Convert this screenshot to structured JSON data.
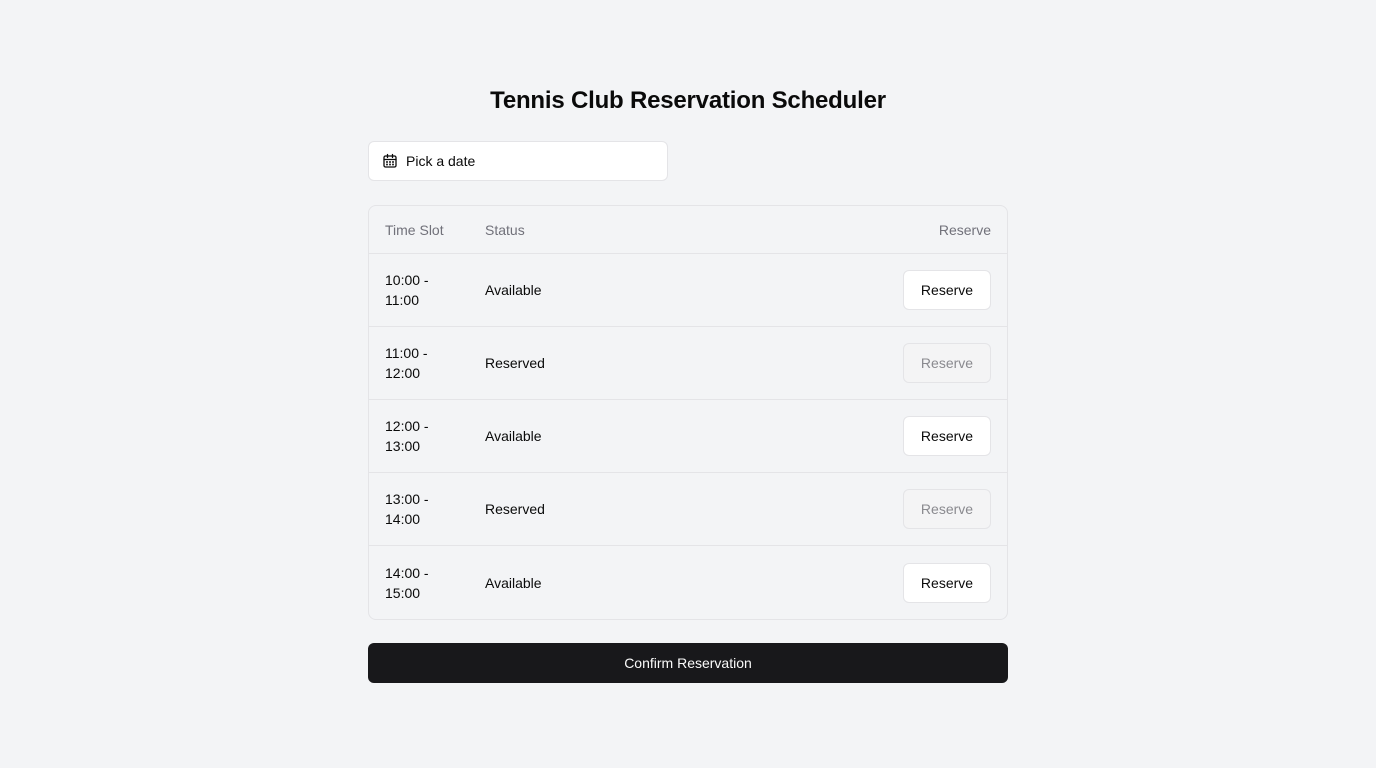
{
  "page": {
    "title": "Tennis Club Reservation Scheduler"
  },
  "date_picker": {
    "icon": "calendar-icon",
    "placeholder": "Pick a date"
  },
  "table": {
    "headers": {
      "time_slot": "Time Slot",
      "status": "Status",
      "reserve": "Reserve"
    },
    "rows": [
      {
        "time_start": "10:00 -",
        "time_end": "11:00",
        "status": "Available",
        "action": "Reserve",
        "disabled": false
      },
      {
        "time_start": "11:00 -",
        "time_end": "12:00",
        "status": "Reserved",
        "action": "Reserve",
        "disabled": true
      },
      {
        "time_start": "12:00 -",
        "time_end": "13:00",
        "status": "Available",
        "action": "Reserve",
        "disabled": false
      },
      {
        "time_start": "13:00 -",
        "time_end": "14:00",
        "status": "Reserved",
        "action": "Reserve",
        "disabled": true
      },
      {
        "time_start": "14:00 -",
        "time_end": "15:00",
        "status": "Available",
        "action": "Reserve",
        "disabled": false
      }
    ]
  },
  "confirm_button": {
    "label": "Confirm Reservation"
  },
  "colors": {
    "background": "#f3f4f6",
    "primary_button": "#18181b",
    "border": "#e4e4e7",
    "muted_text": "#71717a"
  }
}
